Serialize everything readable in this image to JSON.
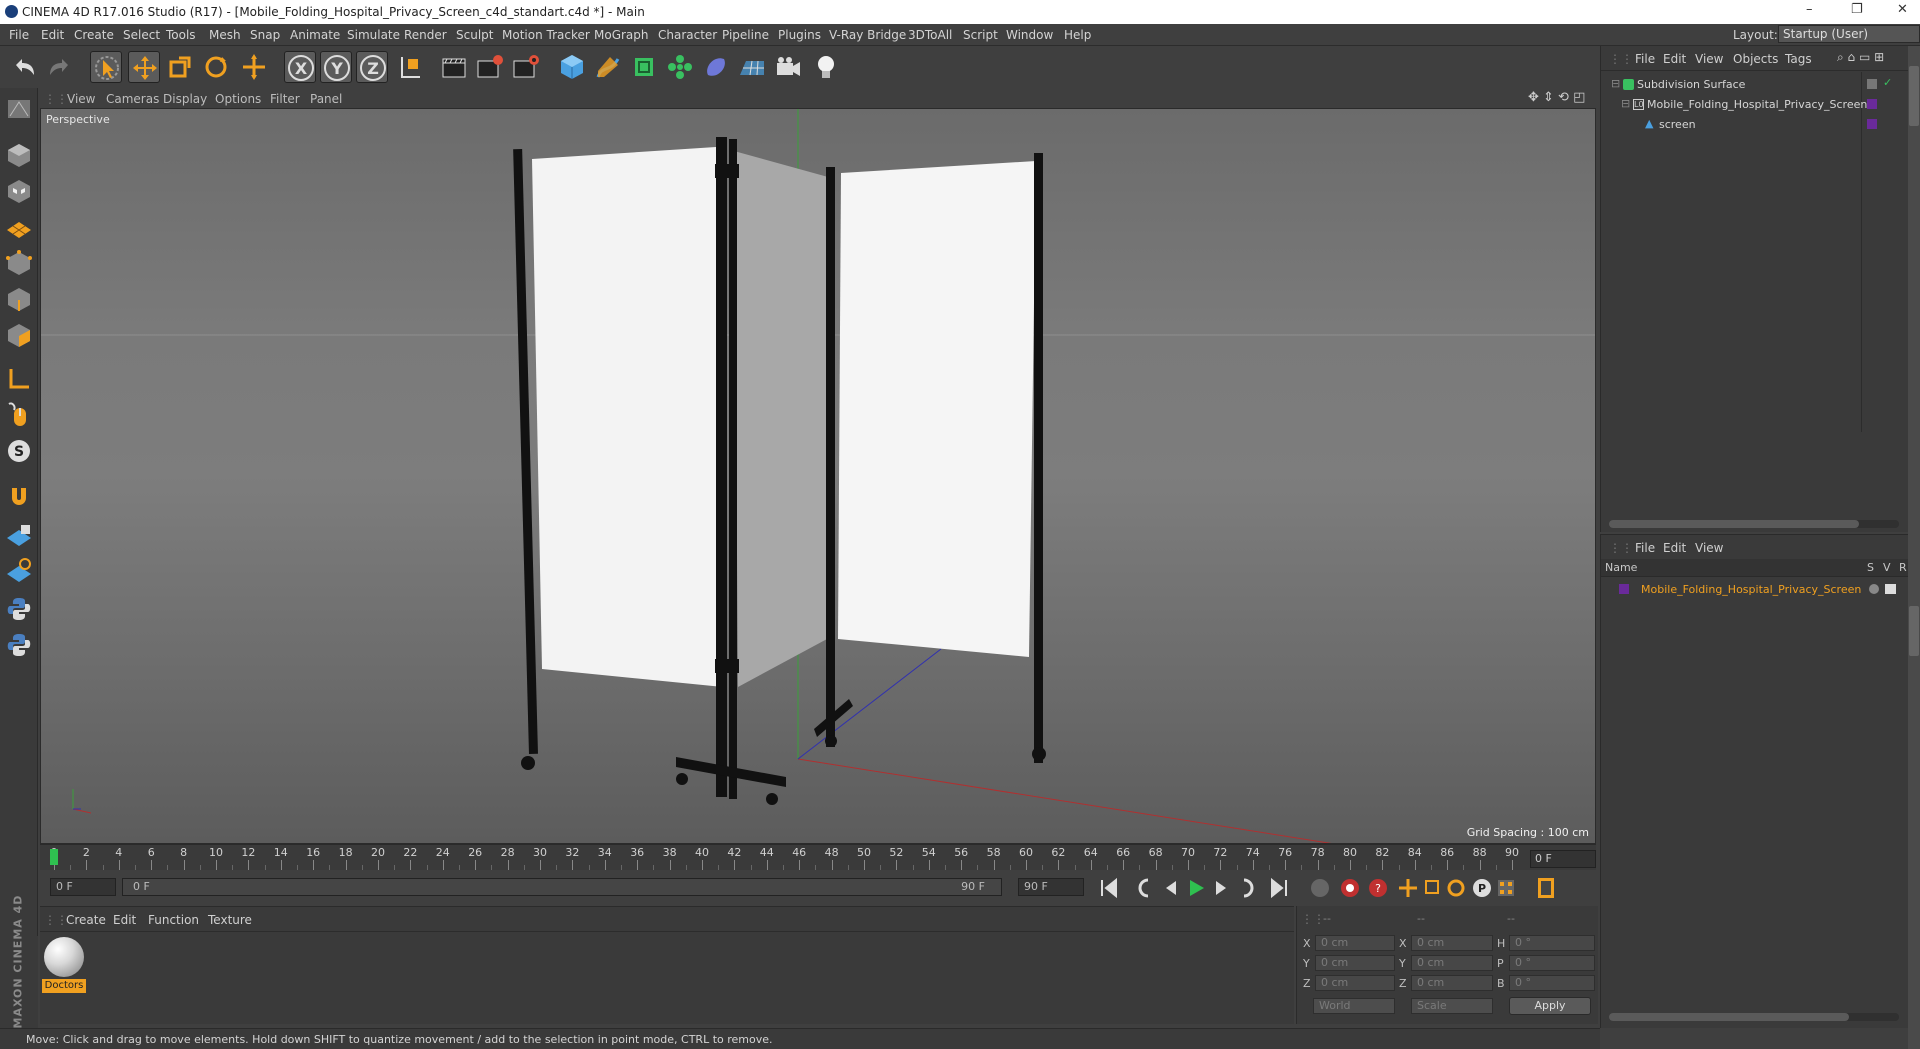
{
  "window": {
    "title": "CINEMA 4D R17.016 Studio (R17) - [Mobile_Folding_Hospital_Privacy_Screen_c4d_standart.c4d *] - Main",
    "controls": [
      "–",
      "❐",
      "✕"
    ]
  },
  "menu": [
    "File",
    "Edit",
    "Create",
    "Select",
    "Tools",
    "Mesh",
    "Snap",
    "Animate",
    "Simulate",
    "Render",
    "Sculpt",
    "Motion Tracker",
    "MoGraph",
    "Character",
    "Pipeline",
    "Plugins",
    "V-Ray Bridge",
    "3DToAll",
    "Script",
    "Window",
    "Help"
  ],
  "layout": {
    "label": "Layout:",
    "value": "Startup (User)"
  },
  "toolbar_icons": [
    "undo-icon",
    "redo-icon",
    "live-selection-icon",
    "move-icon",
    "scale-icon",
    "rotate-icon",
    "add-icon",
    "x-axis-icon",
    "y-axis-icon",
    "z-axis-icon",
    "coordinate-system-icon",
    "render-view-icon",
    "render-picture-viewer-icon",
    "edit-render-settings-icon",
    "cube-icon",
    "pen-icon",
    "subdivision-icon",
    "array-icon",
    "deformer-icon",
    "floor-icon",
    "camera-icon",
    "light-icon"
  ],
  "viewport": {
    "menu": [
      "View",
      "Cameras",
      "Display",
      "Options",
      "Filter",
      "Panel"
    ],
    "label": "Perspective",
    "grid_spacing": "Grid Spacing : 100 cm"
  },
  "timeline": {
    "ticks": [
      "0",
      "2",
      "4",
      "6",
      "8",
      "10",
      "12",
      "14",
      "16",
      "18",
      "20",
      "22",
      "24",
      "26",
      "28",
      "30",
      "32",
      "34",
      "36",
      "38",
      "40",
      "42",
      "44",
      "46",
      "48",
      "50",
      "52",
      "54",
      "56",
      "58",
      "60",
      "62",
      "64",
      "66",
      "68",
      "70",
      "72",
      "74",
      "76",
      "78",
      "80",
      "82",
      "84",
      "86",
      "88",
      "90"
    ],
    "current_frame": "0 F",
    "start": "0 F",
    "range_start": "0 F",
    "range_end": "90 F",
    "end": "90 F"
  },
  "material_manager": {
    "menu": [
      "Create",
      "Edit",
      "Function",
      "Texture"
    ],
    "materials": [
      {
        "name": "Doctors"
      }
    ],
    "brand": "MAXON CINEMA 4D"
  },
  "coordinates": {
    "headers": [
      "--",
      "--",
      "--"
    ],
    "rows": [
      {
        "a": "X",
        "a_val": "0 cm",
        "b": "X",
        "b_val": "0 cm",
        "c": "H",
        "c_val": "0 °"
      },
      {
        "a": "Y",
        "a_val": "0 cm",
        "b": "Y",
        "b_val": "0 cm",
        "c": "P",
        "c_val": "0 °"
      },
      {
        "a": "Z",
        "a_val": "0 cm",
        "b": "Z",
        "b_val": "0 cm",
        "c": "B",
        "c_val": "0 °"
      }
    ],
    "mode": "World",
    "scale": "Scale",
    "apply": "Apply"
  },
  "object_manager": {
    "menu": [
      "File",
      "Edit",
      "View",
      "Objects",
      "Tags"
    ],
    "objects": [
      {
        "name": "Subdivision Surface",
        "icon": "subdivision-icon"
      },
      {
        "name": "Mobile_Folding_Hospital_Privacy_Screen",
        "icon": "null-object-icon"
      },
      {
        "name": "screen",
        "icon": "polygon-object-icon"
      }
    ]
  },
  "attribute_manager": {
    "menu": [
      "File",
      "Edit",
      "View"
    ],
    "columns": {
      "name": "Name",
      "s": "S",
      "v": "V",
      "r": "R"
    },
    "rows": [
      {
        "name": "Mobile_Folding_Hospital_Privacy_Screen"
      }
    ]
  },
  "status": "Move: Click and drag to move elements. Hold down SHIFT to quantize movement / add to the selection in point mode, CTRL to remove.",
  "colors": {
    "accent_orange": "#f0a020",
    "selected_row": "#e8a33a",
    "bg": "#3f3f3f"
  }
}
